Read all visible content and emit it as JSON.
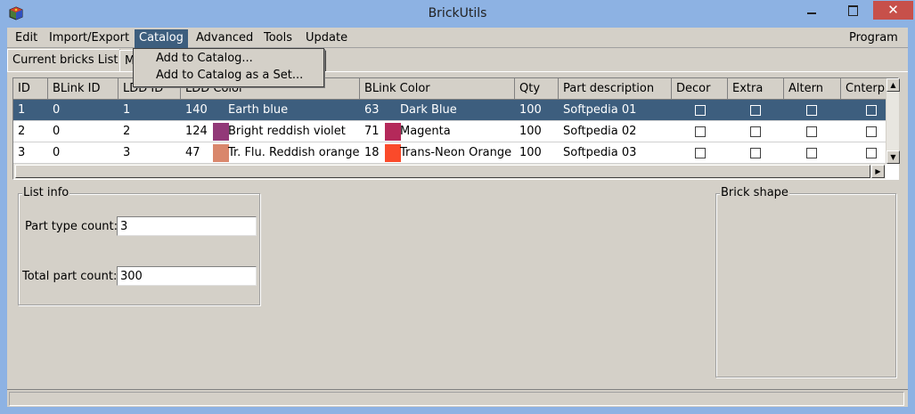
{
  "window": {
    "title": "BrickUtils",
    "close_glyph": "✕"
  },
  "menubar": {
    "items": [
      "Edit",
      "Import/Export",
      "Catalog",
      "Advanced",
      "Tools",
      "Update"
    ],
    "right_item": "Program",
    "open_menu": {
      "name": "Catalog",
      "items": [
        "Add to Catalog...",
        "Add to Catalog as a Set..."
      ]
    }
  },
  "tabs": {
    "items": [
      "Current bricks List",
      "M"
    ],
    "active": "Current bricks List"
  },
  "table": {
    "columns": [
      "ID",
      "BLink ID",
      "LDD ID",
      "LDD Color",
      "BLink Color",
      "Qty",
      "Part description",
      "Decor",
      "Extra",
      "Altern",
      "Cnterp"
    ],
    "rows": [
      {
        "id": "1",
        "blink_id": "0",
        "ldd_id": "1",
        "ldd_color_code": "140",
        "ldd_color_swatch": "#3d5e7e",
        "ldd_color_name": "Earth blue",
        "blink_color_code": "63",
        "blink_color_swatch": "#3d5e7e",
        "blink_color_name": "Dark Blue",
        "qty": "100",
        "description": "Softpedia 01",
        "selected": true
      },
      {
        "id": "2",
        "blink_id": "0",
        "ldd_id": "2",
        "ldd_color_code": "124",
        "ldd_color_swatch": "#923978",
        "ldd_color_name": "Bright reddish violet",
        "blink_color_code": "71",
        "blink_color_swatch": "#b4295a",
        "blink_color_name": "Magenta",
        "qty": "100",
        "description": "Softpedia 02",
        "selected": false
      },
      {
        "id": "3",
        "blink_id": "0",
        "ldd_id": "3",
        "ldd_color_code": "47",
        "ldd_color_swatch": "#d9876c",
        "ldd_color_name": "Tr. Flu. Reddish orange",
        "blink_color_code": "18",
        "blink_color_swatch": "#fa4a2a",
        "blink_color_name": "Trans-Neon Orange",
        "qty": "100",
        "description": "Softpedia 03",
        "selected": false
      }
    ]
  },
  "list_info": {
    "title": "List info",
    "part_type_label": "Part type count:",
    "part_type_value": "3",
    "total_part_label": "Total part count:",
    "total_part_value": "300"
  },
  "brick_shape": {
    "title": "Brick shape"
  },
  "scrollbar": {
    "up": "▲",
    "down": "▼",
    "left": "◀",
    "right": "▶"
  },
  "colors": {
    "selection": "#3d5e7e",
    "titlebar": "#8db2e3",
    "close": "#c7504a",
    "face": "#d4d0c8"
  }
}
